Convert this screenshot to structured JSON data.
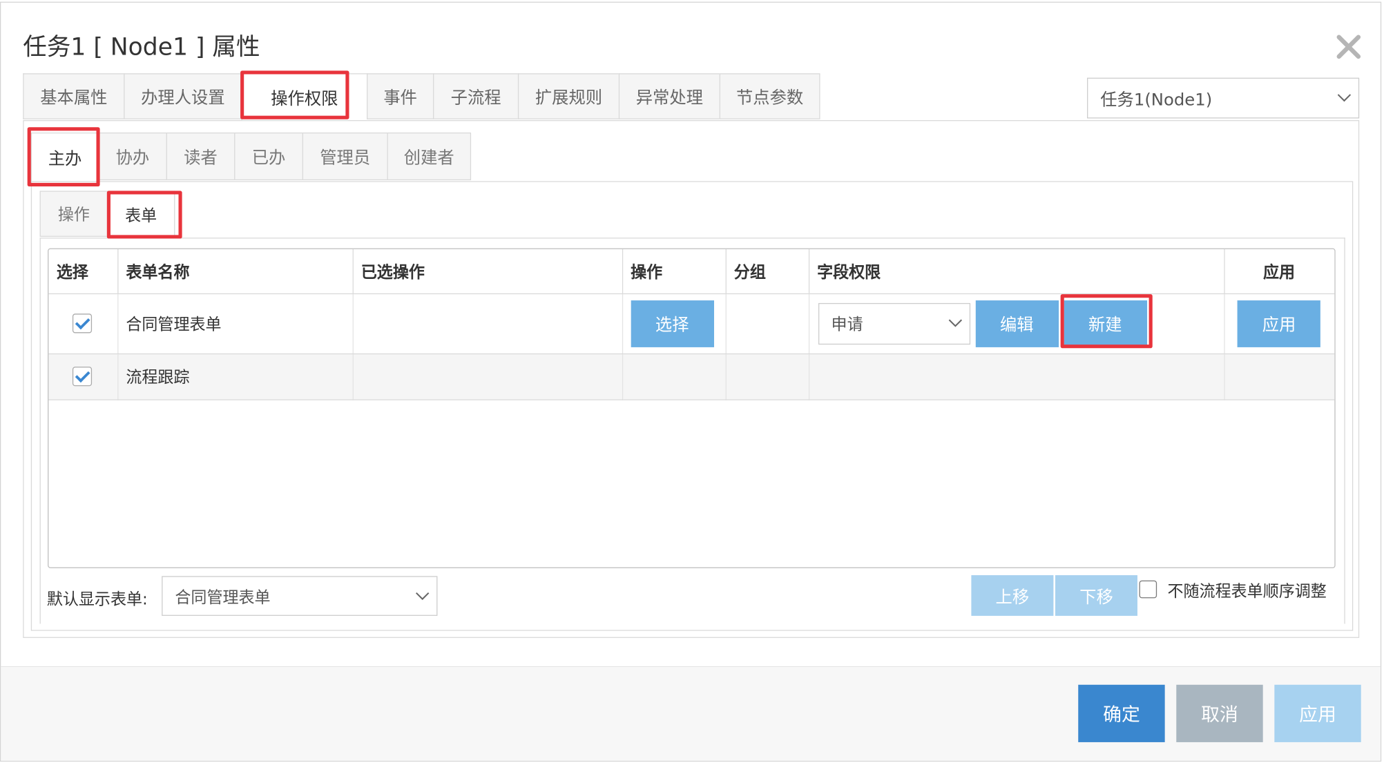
{
  "dialog": {
    "title": "任务1 [ Node1 ] 属性",
    "close_icon": "close-icon"
  },
  "main_tabs": [
    {
      "label": "基本属性",
      "active": false
    },
    {
      "label": "办理人设置",
      "active": false
    },
    {
      "label": "操作权限",
      "active": true
    },
    {
      "label": "事件",
      "active": false
    },
    {
      "label": "子流程",
      "active": false
    },
    {
      "label": "扩展规则",
      "active": false
    },
    {
      "label": "异常处理",
      "active": false
    },
    {
      "label": "节点参数",
      "active": false
    }
  ],
  "node_select": {
    "value": "任务1(Node1)"
  },
  "role_tabs": [
    {
      "label": "主办",
      "active": true
    },
    {
      "label": "协办",
      "active": false
    },
    {
      "label": "读者",
      "active": false
    },
    {
      "label": "已办",
      "active": false
    },
    {
      "label": "管理员",
      "active": false
    },
    {
      "label": "创建者",
      "active": false
    }
  ],
  "sub_tabs": [
    {
      "label": "操作",
      "active": false
    },
    {
      "label": "表单",
      "active": true
    }
  ],
  "table": {
    "headers": [
      "选择",
      "表单名称",
      "已选操作",
      "操作",
      "分组",
      "字段权限",
      "应用"
    ],
    "rows": [
      {
        "checked": true,
        "form_name": "合同管理表单",
        "selected_ops": "",
        "op_button": "选择",
        "group": "",
        "field_perm_value": "申请",
        "edit_button": "编辑",
        "new_button": "新建",
        "apply_button": "应用"
      },
      {
        "checked": true,
        "form_name": "流程跟踪"
      }
    ]
  },
  "default_form": {
    "label": "默认显示表单:",
    "value": "合同管理表单"
  },
  "order": {
    "up_button": "上移",
    "down_button": "下移",
    "checkbox_label": "不随流程表单顺序调整",
    "checked": false
  },
  "footer": {
    "ok_button": "确定",
    "cancel_button": "取消",
    "apply_button": "应用"
  },
  "colors": {
    "highlight": "#e8343c",
    "primary": "#3a87cf",
    "button_blue": "#6aafe3"
  }
}
